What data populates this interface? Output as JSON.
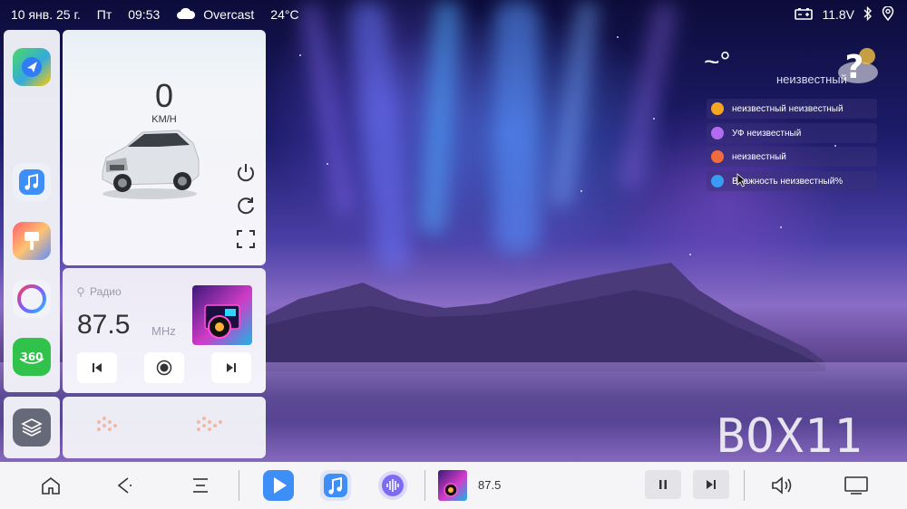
{
  "status_bar": {
    "date": "10 янв. 25 г.",
    "weekday": "Пт",
    "time": "09:53",
    "weather_condition": "Overcast",
    "temperature": "24°C",
    "voltage": "11.8V"
  },
  "car_panel": {
    "speed": "0",
    "speed_unit": "KM/H"
  },
  "radio": {
    "title": "Радио",
    "frequency": "87.5",
    "unit": "MHz"
  },
  "weather": {
    "temp": "~°",
    "label": "неизвестный",
    "rows": [
      {
        "text": "неизвестный неизвестный",
        "color": "#f5a623"
      },
      {
        "text": "УФ неизвестный",
        "color": "#b36bf2"
      },
      {
        "text": "неизвестный",
        "color": "#f26b3a"
      },
      {
        "text": "Влажность неизвестный%",
        "color": "#3a9bf2"
      }
    ]
  },
  "watermark": "BOX11",
  "bottom_bar": {
    "track": "87.5"
  },
  "colors": {
    "accent_blue": "#3e8ef7",
    "text_dark": "#333333"
  }
}
